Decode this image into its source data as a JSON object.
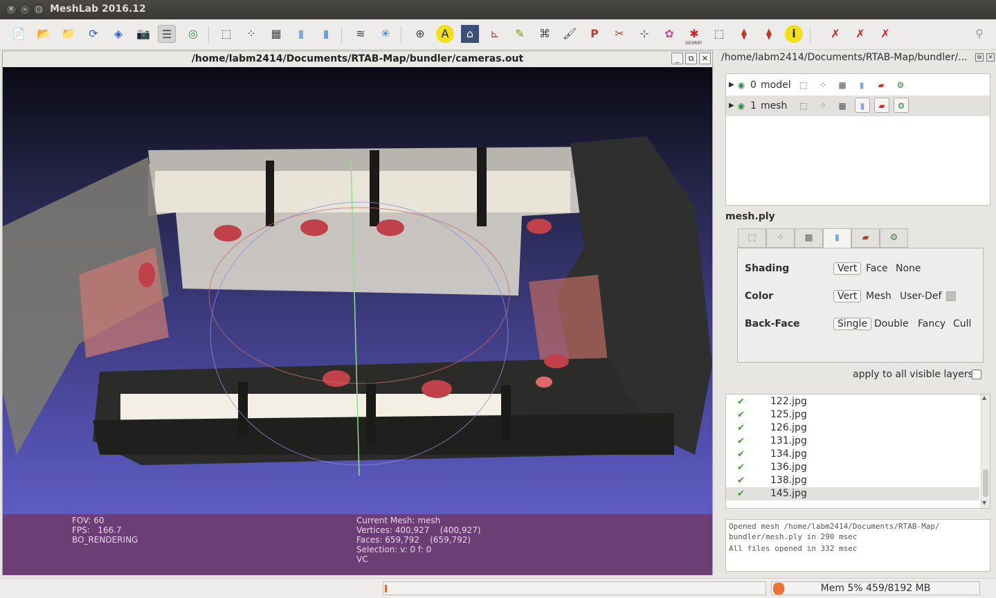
{
  "window": {
    "title": "MeshLab 2016.12",
    "close_glyph": "✕",
    "minimize_glyph": "–",
    "maximize_glyph": "□"
  },
  "toolbar": {
    "icons": [
      "new-icon",
      "open-project-icon",
      "open-file-icon",
      "reload-icon",
      "save-icon",
      "snapshot-icon",
      "layers-icon",
      "globe-icon",
      "bbox-icon",
      "points-icon",
      "wireframe-icon",
      "flat-icon",
      "smooth-icon",
      "lighting-icon",
      "axis-icon",
      "trackball-icon",
      "annotate-icon",
      "museum-icon",
      "measure-icon",
      "pick-icon",
      "brush-icon",
      "paint-icon",
      "select-vertex-icon",
      "select-face-icon",
      "color-icon",
      "georef-icon",
      "select-area-icon",
      "select-faces-icon",
      "select-conn-icon",
      "info-icon",
      "delete-vert-icon",
      "delete-face-icon",
      "delete-both-icon",
      "search-icon"
    ],
    "georef_label": "GEOREF"
  },
  "document": {
    "title": "/home/labm2414/Documents/RTAB-Map/bundler/cameras.out",
    "min_glyph": "_",
    "restore_glyph": "⧉",
    "close_glyph": "✕"
  },
  "viewport": {
    "info_left": {
      "fov": "FOV: 60",
      "fps": "FPS:   166.7",
      "mode": "BO_RENDERING"
    },
    "info_right": {
      "current_mesh": "Current Mesh: mesh",
      "vertices": "Vertices: 400,927    (400,927)",
      "faces": "Faces: 659,792    (659,792)",
      "selection": "Selection: v: 0 f: 0",
      "vc": "VC"
    }
  },
  "right_panel": {
    "title": "/home/labm2414/Documents/RTAB-Map/bundler/...",
    "layers": [
      {
        "index": "0",
        "name": "model"
      },
      {
        "index": "1",
        "name": "mesh"
      }
    ],
    "mesh_name": "mesh.ply",
    "render": {
      "shading_label": "Shading",
      "shading_options": [
        "Vert",
        "Face",
        "None"
      ],
      "color_label": "Color",
      "color_options": [
        "Vert",
        "Mesh",
        "User-Def"
      ],
      "backface_label": "Back-Face",
      "backface_options": [
        "Single",
        "Double",
        "Fancy",
        "Cull"
      ]
    },
    "apply_all_label": "apply to all visible layers",
    "images": [
      "122.jpg",
      "125.jpg",
      "126.jpg",
      "131.jpg",
      "134.jpg",
      "136.jpg",
      "138.jpg",
      "145.jpg"
    ],
    "log": [
      "Opened mesh /home/labm2414/Documents/RTAB-Map/",
      "bundler/mesh.ply in 290 msec",
      "All files opened in 332 msec"
    ]
  },
  "status": {
    "memory": "Mem 5% 459/8192 MB"
  },
  "colors": {
    "info_bar": "#6d3d75",
    "check": "#3aa12e"
  }
}
